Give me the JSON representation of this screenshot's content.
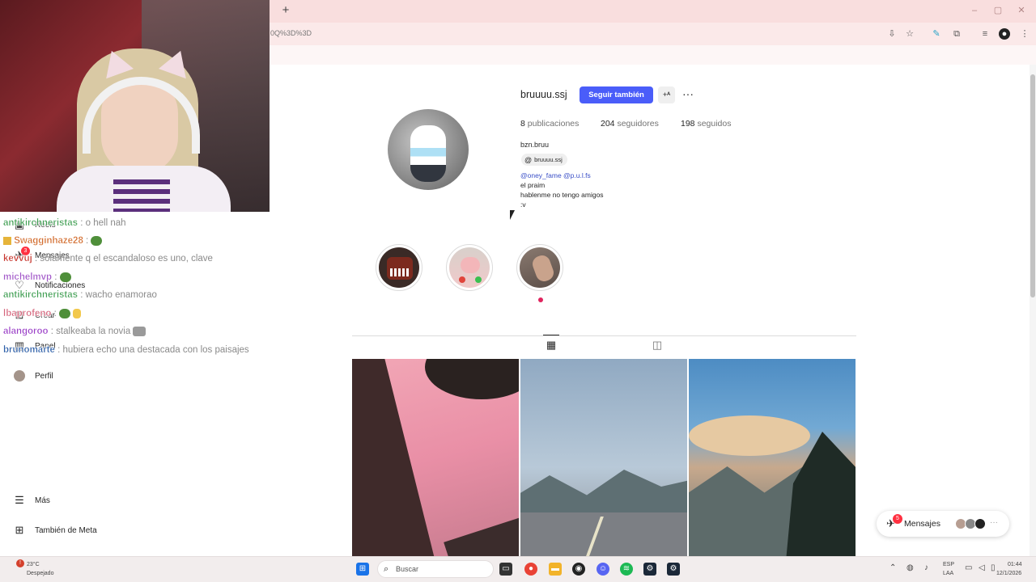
{
  "browser": {
    "new_tab_label": "+",
    "url_fragment": "0Q%3D%3D",
    "window_controls": [
      "–",
      "▢",
      "✕"
    ]
  },
  "nav": {
    "items": [
      {
        "label": "Reels",
        "icon": "reels-icon"
      },
      {
        "label": "Mensajes",
        "icon": "messages-icon",
        "badge": "3"
      },
      {
        "label": "Notificaciones",
        "icon": "heart-icon"
      },
      {
        "label": "Crear",
        "icon": "create-icon"
      },
      {
        "label": "Panel",
        "icon": "dashboard-icon"
      },
      {
        "label": "Perfil",
        "icon": "profile-avatar"
      }
    ],
    "more_label": "Más",
    "meta_label": "También de Meta"
  },
  "chat": [
    {
      "user": "antikirchneristas",
      "color": "#3f9e52",
      "msg": ": o hell nah"
    },
    {
      "user": "Swagginhaze28",
      "color": "#d26a2a",
      "msg": ":"
    },
    {
      "user": "kevvuj",
      "color": "#c7352d",
      "msg": ": solamente q el escandaloso es uno, clave"
    },
    {
      "user": "michelmvp",
      "color": "#a258c9",
      "msg": ":"
    },
    {
      "user": "antikirchneristas",
      "color": "#3f9e52",
      "msg": ": wacho enamorao"
    },
    {
      "user": "lbaprofeno",
      "color": "#d6657c",
      "msg": ":"
    },
    {
      "user": "alangoroo",
      "color": "#9a3fc7",
      "msg": ": stalkeaba la novia"
    },
    {
      "user": "brunomarte",
      "color": "#2d5fa8",
      "msg": ": hubiera echo una destacada con los paisajes"
    }
  ],
  "profile": {
    "username": "bruuuu.ssj",
    "follow_label": "Seguir también",
    "suggest_label": "+ᴬ",
    "options_label": "···",
    "stats": [
      {
        "count": "8",
        "label": "publicaciones"
      },
      {
        "count": "204",
        "label": "seguidores"
      },
      {
        "count": "198",
        "label": "seguidos"
      }
    ],
    "full_name": "bzn.bruu",
    "threads_handle": "bruuuu.ssj",
    "bio_mentions": "@oney_fame @p.u.l.fs",
    "bio_lines": [
      "el praim",
      "hablenme no tengo amigos",
      ":v"
    ]
  },
  "messages_pill": {
    "label": "Mensajes",
    "badge": "5"
  },
  "taskbar": {
    "weather_temp": "23°C",
    "weather_desc": "Despejado",
    "search_label": "Buscar",
    "lang": "ESP",
    "lang_region": "LAA",
    "time": "01:44",
    "date": "12/1/2026"
  },
  "colors": {
    "accent": "#4a5df9",
    "tabbar": "#f9dede",
    "badge": "#ff3040"
  }
}
